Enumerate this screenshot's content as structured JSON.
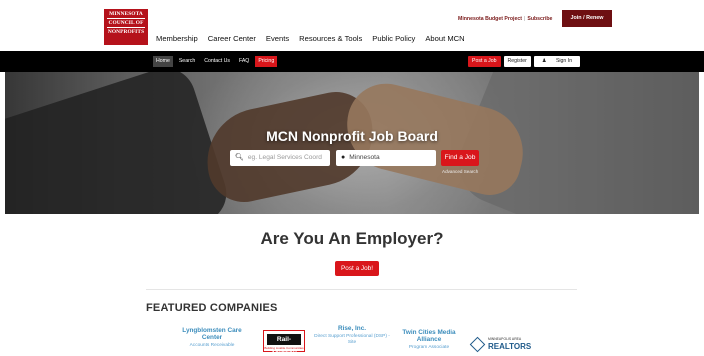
{
  "logo": {
    "line1": "MINNESOTA",
    "line2": "COUNCIL OF",
    "line3": "NONPROFITS"
  },
  "main_nav": [
    "Membership",
    "Career Center",
    "Events",
    "Resources & Tools",
    "Public Policy",
    "About MCN"
  ],
  "utility": {
    "budget_project": "Minnesota Budget Project",
    "subscribe": "Subscribe",
    "join_renew": "Join / Renew"
  },
  "sub_nav": {
    "home": "Home",
    "search": "Search",
    "contact": "Contact Us",
    "faq": "FAQ",
    "pricing": "Pricing",
    "post_job": "Post a Job",
    "register": "Register",
    "sign_in": "Sign In"
  },
  "hero": {
    "title": "MCN Nonprofit Job Board",
    "keyword_placeholder": "eg. Legal Services Coord",
    "location_value": "Minnesota",
    "find_button": "Find a Job",
    "advanced": "Advanced Search"
  },
  "employer": {
    "heading": "Are You An Employer?",
    "post_button": "Post a Job!"
  },
  "featured": {
    "heading": "FEATURED COMPANIES",
    "companies": [
      {
        "name": "Lyngblomsten Care Center",
        "job": "Accounts Receivable"
      },
      {
        "name": "Rail-Volution",
        "tag": "Building Livable Communities"
      },
      {
        "name": "Rise, Inc.",
        "job": "Direct Support Professional (DSP) - Site"
      },
      {
        "name": "Twin Cities Media Alliance",
        "job": "Program Associate"
      },
      {
        "name": "REALTORS",
        "mini": "MINNEAPOLIS AREA"
      }
    ]
  },
  "colors": {
    "brand_red": "#d9161b",
    "logo_red": "#b5121b",
    "dark_red": "#6e0f12",
    "link_blue": "#3c8dbc"
  }
}
